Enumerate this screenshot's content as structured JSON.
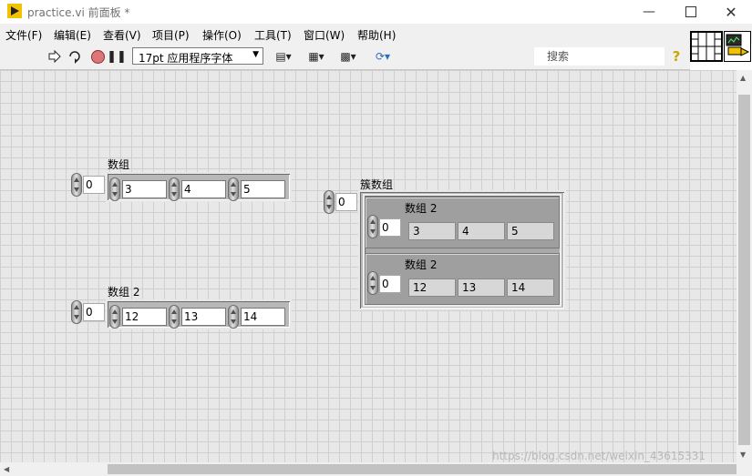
{
  "window": {
    "title": "practice.vi 前面板 *",
    "icons": {
      "app": "labview-vi-icon",
      "minimize": "minimize-icon",
      "maximize": "maximize-icon",
      "close": "close-icon"
    }
  },
  "menu": [
    "文件(F)",
    "编辑(E)",
    "查看(V)",
    "项目(P)",
    "操作(O)",
    "工具(T)",
    "窗口(W)",
    "帮助(H)"
  ],
  "toolbar": {
    "font": "17pt 应用程序字体",
    "search_placeholder": "搜索",
    "icons": [
      "run-arrow-icon",
      "run-continuously-icon",
      "abort-icon",
      "pause-icon",
      "align-objects-icon",
      "distribute-objects-icon",
      "resize-objects-icon",
      "reorder-icon",
      "search-icon",
      "help-icon"
    ]
  },
  "front_panel": {
    "array1": {
      "label": "数组",
      "index": "0",
      "values": [
        "3",
        "4",
        "5"
      ]
    },
    "array2": {
      "label": "数组 2",
      "index": "0",
      "values": [
        "12",
        "13",
        "14"
      ]
    },
    "cluster_array": {
      "label": "簇数组",
      "index": "0",
      "element": [
        {
          "label": "数组 2",
          "index": "0",
          "values": [
            "3",
            "4",
            "5"
          ]
        },
        {
          "label": "数组 2",
          "index": "0",
          "values": [
            "12",
            "13",
            "14"
          ]
        }
      ]
    }
  },
  "watermark": "https://blog.csdn.net/weixin_43615331"
}
